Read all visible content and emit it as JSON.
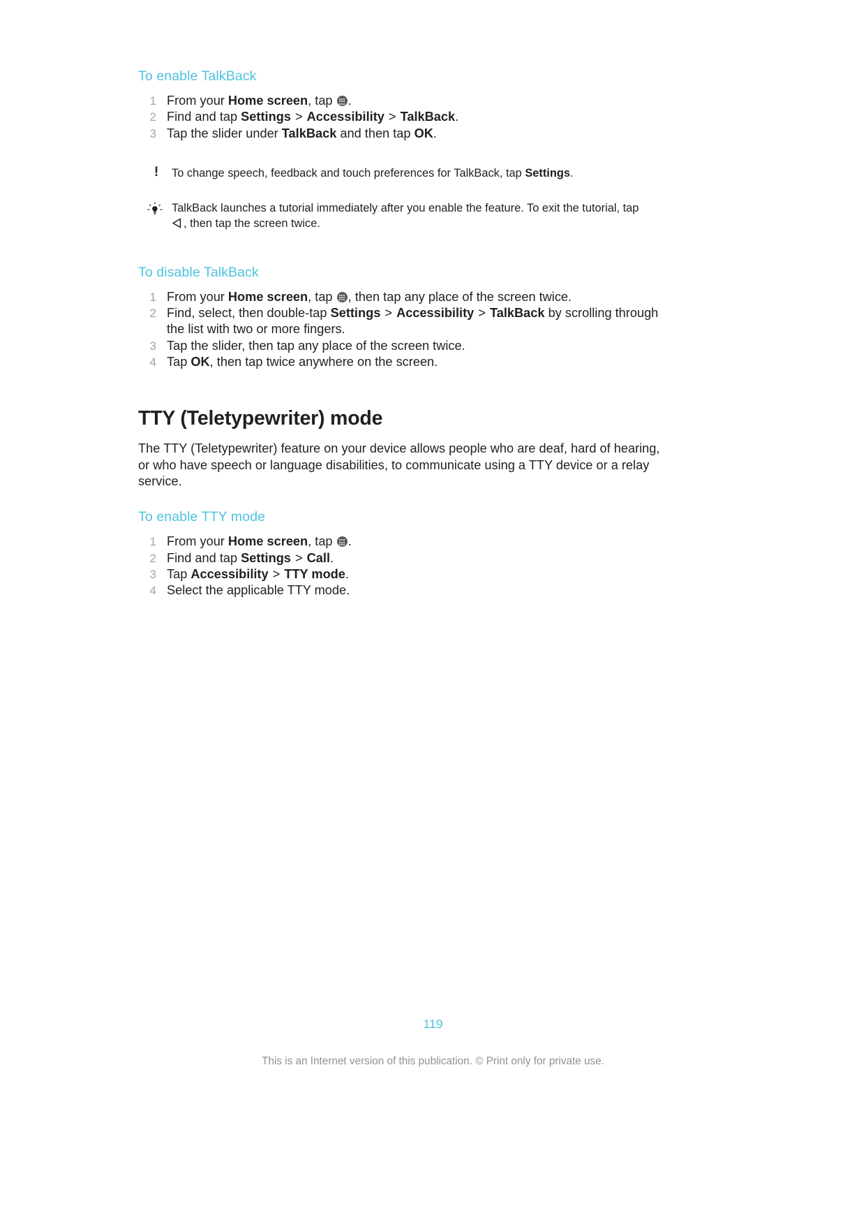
{
  "document": {
    "page_number": "119",
    "disclaimer": "This is an Internet version of this publication. © Print only for private use."
  },
  "sections": {
    "enable_talkback": {
      "heading": "To enable TalkBack",
      "steps": [
        {
          "parts": [
            {
              "text": "From your ",
              "style": "normal"
            },
            {
              "text": "Home screen",
              "style": "bold"
            },
            {
              "text": ", tap ",
              "style": "normal"
            },
            {
              "icon": "app-drawer-icon"
            },
            {
              "text": ".",
              "style": "normal"
            }
          ],
          "plain": "From your Home screen, tap ."
        },
        {
          "parts": [
            {
              "text": "Find and tap ",
              "style": "normal"
            },
            {
              "text": "Settings",
              "style": "bold"
            },
            {
              "text": " > ",
              "style": "sep"
            },
            {
              "text": "Accessibility",
              "style": "bold"
            },
            {
              "text": " > ",
              "style": "sep"
            },
            {
              "text": "TalkBack",
              "style": "bold"
            },
            {
              "text": ".",
              "style": "normal"
            }
          ],
          "plain": "Find and tap Settings > Accessibility > TalkBack."
        },
        {
          "parts": [
            {
              "text": "Tap the slider under ",
              "style": "normal"
            },
            {
              "text": "TalkBack",
              "style": "bold"
            },
            {
              "text": " and then tap ",
              "style": "normal"
            },
            {
              "text": "OK",
              "style": "bold"
            },
            {
              "text": ".",
              "style": "normal"
            }
          ],
          "plain": "Tap the slider under TalkBack and then tap OK."
        }
      ],
      "note": {
        "icon": "exclamation-note-icon",
        "glyph": "!",
        "text_before": "To change speech, feedback and touch preferences for TalkBack, tap ",
        "bold": "Settings",
        "text_after": ".",
        "plain": "To change speech, feedback and touch preferences for TalkBack, tap Settings."
      },
      "tip": {
        "icon": "lightbulb-tip-icon",
        "line1": "TalkBack launches a tutorial immediately after you enable the feature. To exit the tutorial, tap",
        "line2_icon": "back-arrow-icon",
        "line2": ", then tap the screen twice.",
        "plain": "TalkBack launches a tutorial immediately after you enable the feature. To exit the tutorial, tap , then tap the screen twice."
      }
    },
    "disable_talkback": {
      "heading": "To disable TalkBack",
      "steps": [
        {
          "parts": [
            {
              "text": "From your ",
              "style": "normal"
            },
            {
              "text": "Home screen",
              "style": "bold"
            },
            {
              "text": ", tap ",
              "style": "normal"
            },
            {
              "icon": "app-drawer-icon"
            },
            {
              "text": ", then tap any place of the screen twice.",
              "style": "normal"
            }
          ],
          "plain": "From your Home screen, tap , then tap any place of the screen twice."
        },
        {
          "parts": [
            {
              "text": "Find, select, then double-tap ",
              "style": "normal"
            },
            {
              "text": "Settings",
              "style": "bold"
            },
            {
              "text": " > ",
              "style": "sep"
            },
            {
              "text": "Accessibility",
              "style": "bold"
            },
            {
              "text": " > ",
              "style": "sep"
            },
            {
              "text": "TalkBack",
              "style": "bold"
            },
            {
              "text": " by scrolling through the list with two or more fingers.",
              "style": "normal"
            }
          ],
          "plain": "Find, select, then double-tap Settings > Accessibility > TalkBack by scrolling through the list with two or more fingers."
        },
        {
          "parts": [
            {
              "text": "Tap the slider, then tap any place of the screen twice.",
              "style": "normal"
            }
          ],
          "plain": "Tap the slider, then tap any place of the screen twice."
        },
        {
          "parts": [
            {
              "text": "Tap ",
              "style": "normal"
            },
            {
              "text": "OK",
              "style": "bold"
            },
            {
              "text": ", then tap twice anywhere on the screen.",
              "style": "normal"
            }
          ],
          "plain": "Tap OK, then tap twice anywhere on the screen."
        }
      ]
    },
    "tty": {
      "title": "TTY (Teletypewriter) mode",
      "body": "The TTY (Teletypewriter) feature on your device allows people who are deaf, hard of hearing, or who have speech or language disabilities, to communicate using a TTY device or a relay service.",
      "enable": {
        "heading": "To enable TTY mode",
        "steps": [
          {
            "parts": [
              {
                "text": "From your ",
                "style": "normal"
              },
              {
                "text": "Home screen",
                "style": "bold"
              },
              {
                "text": ", tap ",
                "style": "normal"
              },
              {
                "icon": "app-drawer-icon"
              },
              {
                "text": ".",
                "style": "normal"
              }
            ],
            "plain": "From your Home screen, tap ."
          },
          {
            "parts": [
              {
                "text": "Find and tap ",
                "style": "normal"
              },
              {
                "text": "Settings",
                "style": "bold"
              },
              {
                "text": " > ",
                "style": "sep"
              },
              {
                "text": "Call",
                "style": "bold"
              },
              {
                "text": ".",
                "style": "normal"
              }
            ],
            "plain": "Find and tap Settings > Call."
          },
          {
            "parts": [
              {
                "text": "Tap ",
                "style": "normal"
              },
              {
                "text": "Accessibility",
                "style": "bold"
              },
              {
                "text": " > ",
                "style": "sep"
              },
              {
                "text": "TTY mode",
                "style": "bold"
              },
              {
                "text": ".",
                "style": "normal"
              }
            ],
            "plain": "Tap Accessibility > TTY mode."
          },
          {
            "parts": [
              {
                "text": "Select the applicable TTY mode.",
                "style": "normal"
              }
            ],
            "plain": "Select the applicable TTY mode."
          }
        ]
      }
    }
  },
  "colors": {
    "accent": "#4ec3e0",
    "text": "#231f20",
    "list_number": "#a3a3a3",
    "footer_text": "#929292",
    "icon_bg": "#5a5a5a"
  }
}
